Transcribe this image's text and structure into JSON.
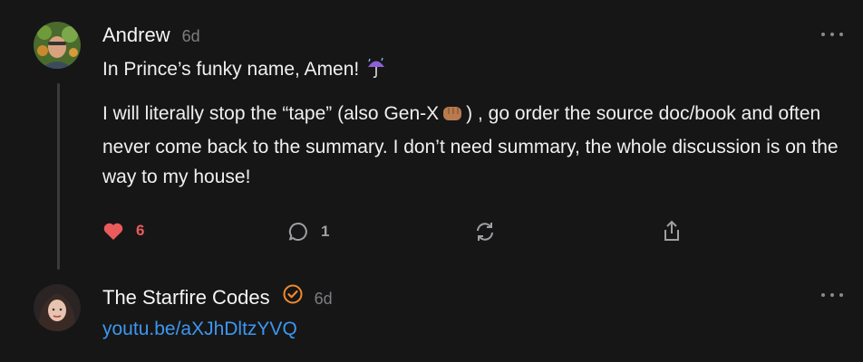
{
  "comments": [
    {
      "author": "Andrew",
      "time": "6d",
      "paragraphs": [
        "In Prince’s funky name, Amen!",
        "I will literally stop the “tape” (also Gen-X",
        ") , go order the source doc/book and often never come back to the summary. I don’t need summary, the whole discussion is on the way to my house!"
      ],
      "emojis": [
        "umbrella-with-rain-icon",
        "fist-bump-icon"
      ],
      "likes": "6",
      "replies": "1"
    },
    {
      "author": "The Starfire Codes",
      "time": "6d",
      "link": "youtu.be/aXJhDltzYVQ",
      "verified": true
    }
  ],
  "colors": {
    "background": "#161617",
    "like": "#ea5b5b",
    "link": "#3d97ee",
    "verified": "#f08a2c"
  }
}
